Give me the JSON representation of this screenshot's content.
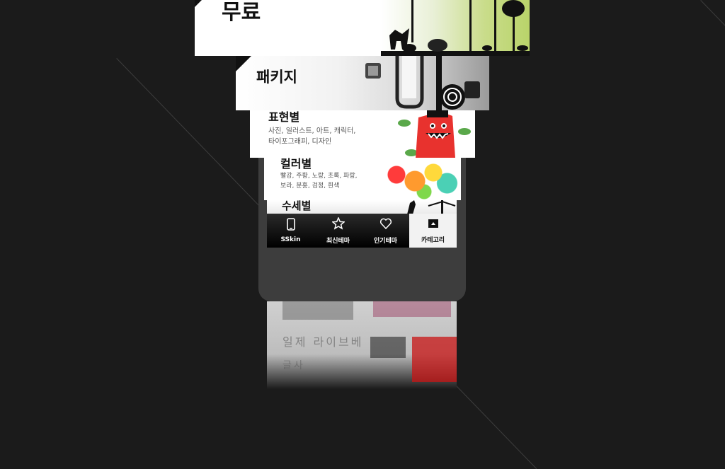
{
  "cards": {
    "free": {
      "title": "무료"
    },
    "package": {
      "title": "패키지"
    },
    "expression": {
      "title": "표현별",
      "sub1": "사진, 일러스트, 아트, 캐릭터,",
      "sub2": "타이포그래피, 디자인"
    },
    "color": {
      "title": "컬러별",
      "sub1": "빨강, 주황, 노랑, 초록, 파랑,",
      "sub2": "보라, 분홍, 검정, 흰색"
    },
    "watercolor": {
      "title": "수세별"
    }
  },
  "tabs": [
    {
      "label": "SSkin",
      "icon": "phone-icon"
    },
    {
      "label": "최신테마",
      "icon": "star-icon"
    },
    {
      "label": "인기테마",
      "icon": "heart-icon"
    },
    {
      "label": "카테고리",
      "icon": "category-icon",
      "active": true
    }
  ],
  "reflection": {
    "text1": "일제 라이브베",
    "text2": "글사"
  },
  "colors": {
    "background": "#1b1b1b",
    "phone_body": "#3d3d3d",
    "active_tab": "#f2f2f2"
  }
}
